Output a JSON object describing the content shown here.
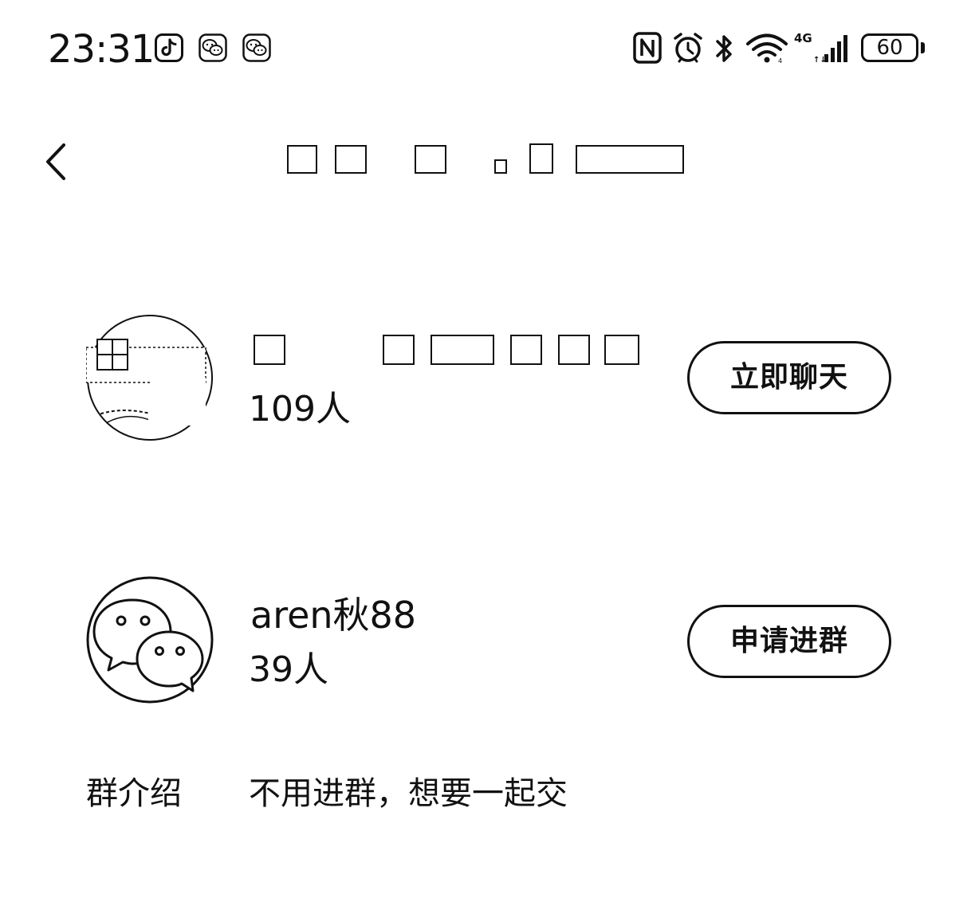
{
  "status_bar": {
    "time": "23:31",
    "notification_icons": [
      "tiktok-icon",
      "wechat-icon",
      "wechat-icon"
    ],
    "system_icons": [
      "nfc-icon",
      "alarm-icon",
      "bluetooth-icon",
      "wifi-icon",
      "signal-icon"
    ],
    "network_label": "4G",
    "battery_level": "60"
  },
  "nav": {
    "back_icon": "chevron-left-icon",
    "title": ""
  },
  "groups": [
    {
      "name": "",
      "count": "109人",
      "action_label": "立即聊天",
      "avatar": "photo-avatar"
    },
    {
      "name": "aren秋88",
      "count": "39人",
      "action_label": "申请进群",
      "avatar": "wechat-group-icon"
    }
  ],
  "intro": {
    "label": "群介绍",
    "text": "不用进群，想要一起交"
  },
  "colors": {
    "background": "#ffffff",
    "foreground": "#111111"
  }
}
